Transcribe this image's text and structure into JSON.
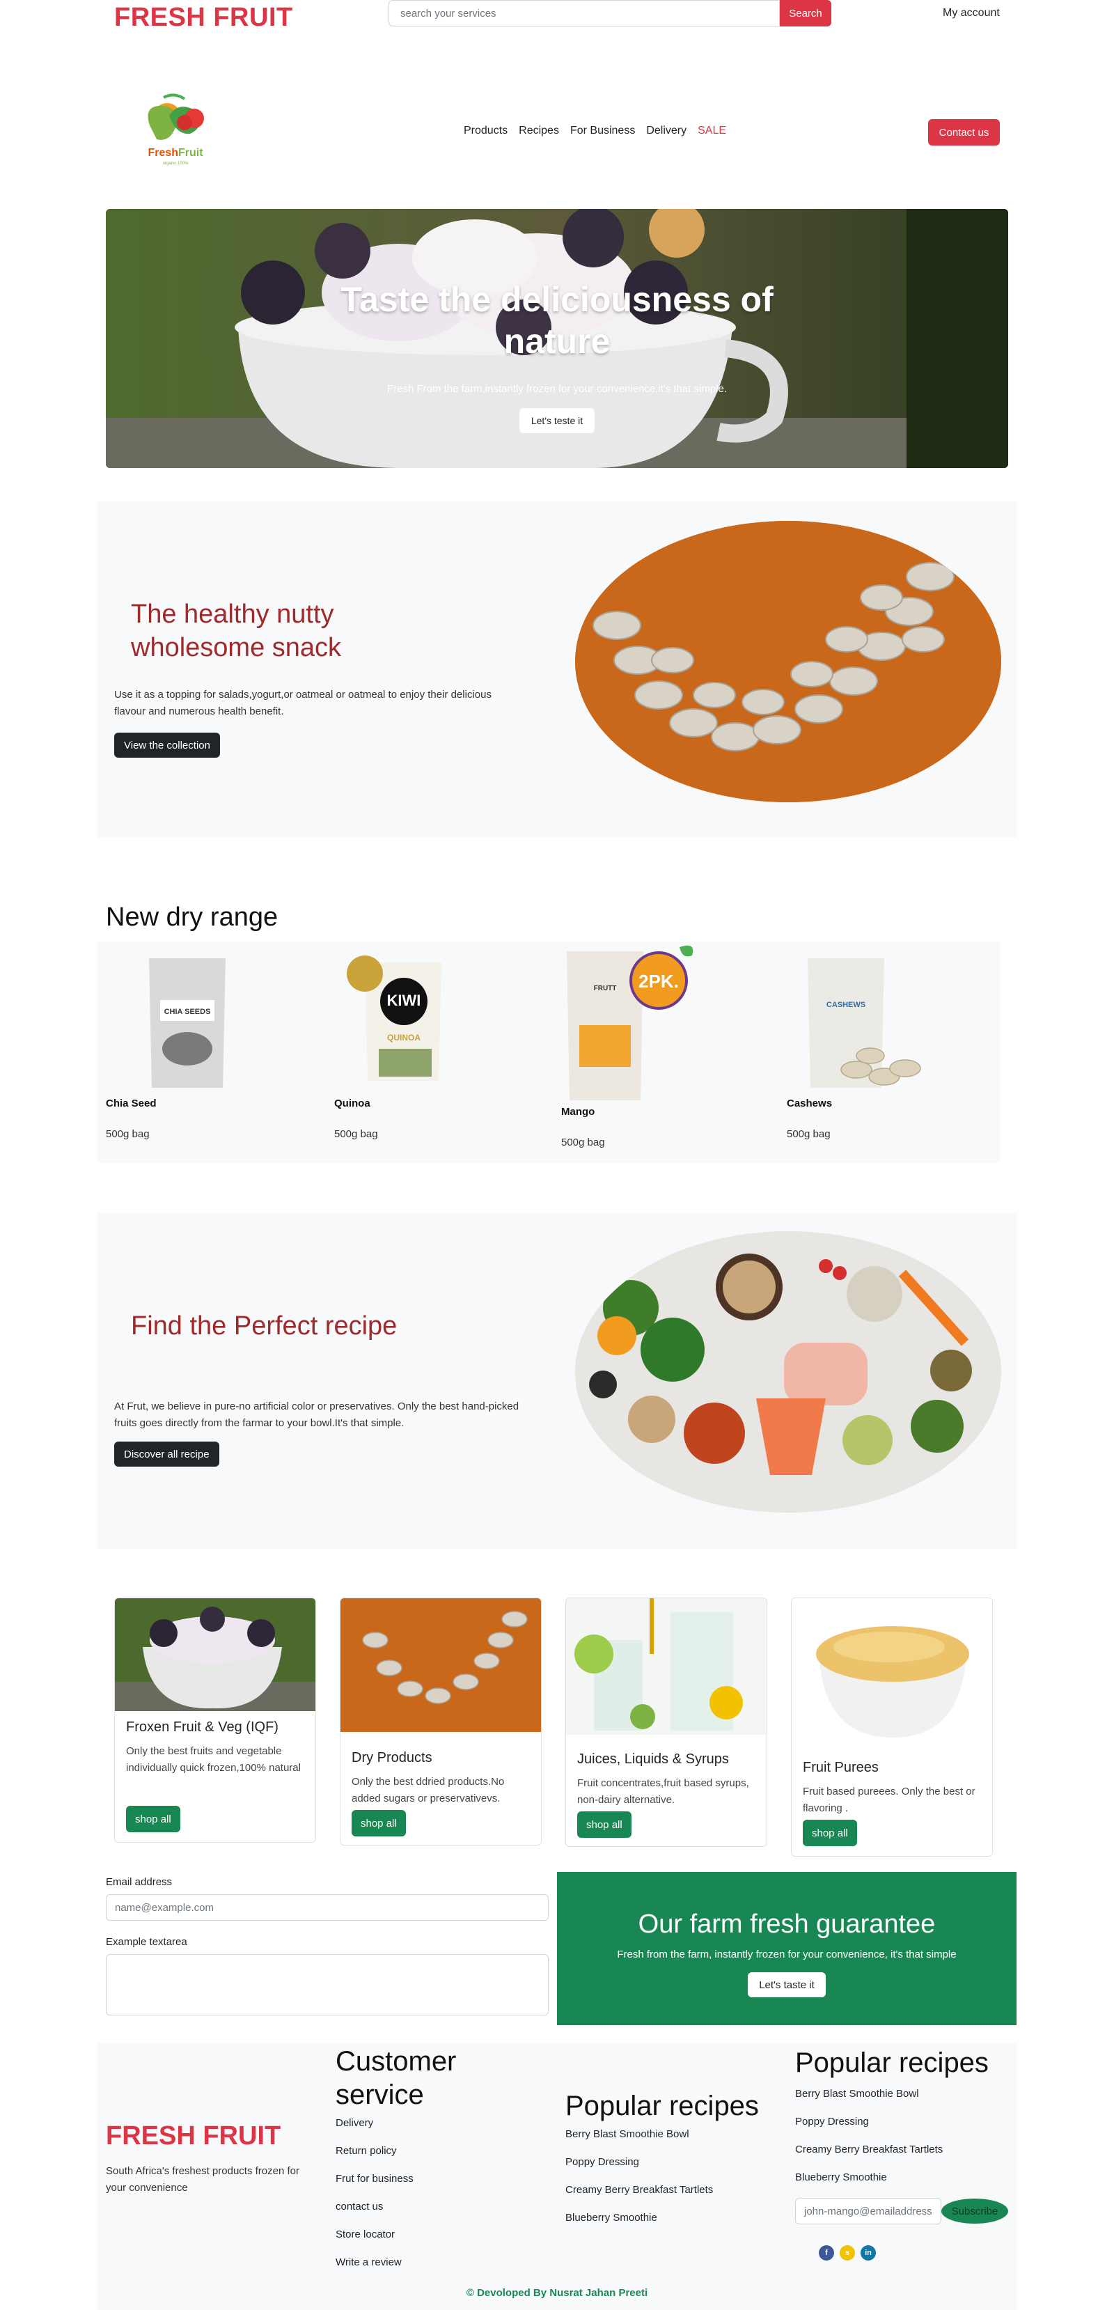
{
  "header": {
    "brand": "FRESH FRUIT",
    "search_placeholder": "search your services",
    "search_button": "Search",
    "account": "My account"
  },
  "nav": {
    "items": [
      "Products",
      "Recipes",
      "For Business",
      "Delivery",
      "SALE"
    ],
    "contact": "Contact us"
  },
  "hero": {
    "title": "Taste the deliciousness of nature",
    "subtitle": "Fresh From the farm,instantly frozen for your convenience,it's that simple.",
    "button": "Let's teste it"
  },
  "snack": {
    "title": "The healthy nutty wholesome snack",
    "text": "Use it as a topping for salads,yogurt,or oatmeal or oatmeal to enjoy their delicious flavour and numerous health benefit.",
    "button": "View the collection"
  },
  "dry_range": {
    "title": "New dry range",
    "items": [
      {
        "name": "Chia Seed",
        "size": "500g bag",
        "colors": [
          "#d9d9d9",
          "#7a7a7a"
        ]
      },
      {
        "name": "Quinoa",
        "size": "500g bag",
        "colors": [
          "#ffffff",
          "#111111"
        ]
      },
      {
        "name": "Mango",
        "size": "500g bag",
        "colors": [
          "#f2a531",
          "#e8e2d6"
        ]
      },
      {
        "name": "Cashews",
        "size": "500g bag",
        "colors": [
          "#e9e6dc",
          "#2b6fb0"
        ]
      }
    ]
  },
  "recipe": {
    "title": "Find the Perfect recipe",
    "text": "At Frut, we believe in pure-no artificial color or preservatives. Only the best hand-picked fruits goes directly from the farmar to your bowl.It's that simple.",
    "button": "Discover all recipe"
  },
  "cards": [
    {
      "title": "Froxen Fruit & Veg (IQF)",
      "text": "Only the best fruits and vegetable individually quick frozen,100% natural",
      "button": "shop all"
    },
    {
      "title": "Dry Products",
      "text": "Only the best ddried products.No added sugars or preservativevs.",
      "button": "shop all"
    },
    {
      "title": "Juices, Liquids & Syrups",
      "text": "Fruit concentrates,fruit based syrups, non-dairy alternative.",
      "button": "shop all"
    },
    {
      "title": "Fruit Purees",
      "text": "Fruit based pureees. Only the best or flavoring .",
      "button": "shop all"
    }
  ],
  "form": {
    "email_label": "Email address",
    "email_placeholder": "name@example.com",
    "textarea_label": "Example textarea"
  },
  "guarantee": {
    "title": "Our farm fresh guarantee",
    "subtitle": "Fresh from the farm, instantly frozen for your convenience, it's that simple",
    "button": "Let's taste it"
  },
  "footer": {
    "brand": "FRESH FRUIT",
    "tagline": "South Africa's freshest products frozen for your convenience",
    "customer_service": {
      "heading": "Customer service",
      "links": [
        "Delivery",
        "Return policy",
        "Frut for business",
        "contact us",
        "Store locator",
        "Write a review"
      ]
    },
    "popular_recipes_1": {
      "heading": "Popular recipes",
      "links": [
        "Berry Blast Smoothie Bowl",
        "Poppy Dressing",
        "Creamy Berry Breakfast Tartlets",
        "Blueberry Smoothie"
      ]
    },
    "popular_recipes_2": {
      "heading": "Popular recipes",
      "links": [
        "Berry Blast Smoothie Bowl",
        "Poppy Dressing",
        "Creamy Berry Breakfast Tartlets",
        "Blueberry Smoothie"
      ]
    },
    "newsletter_placeholder": "john-mango@emailaddress",
    "subscribe": "Subscribe",
    "social": [
      {
        "icon": "facebook-icon",
        "glyph": "f",
        "color": "#3b5998"
      },
      {
        "icon": "snapchat-icon",
        "glyph": "s",
        "color": "#f2c200"
      },
      {
        "icon": "linkedin-icon",
        "glyph": "in",
        "color": "#0e76a8"
      }
    ],
    "credit": "© Devoloped By Nusrat Jahan Preeti"
  }
}
